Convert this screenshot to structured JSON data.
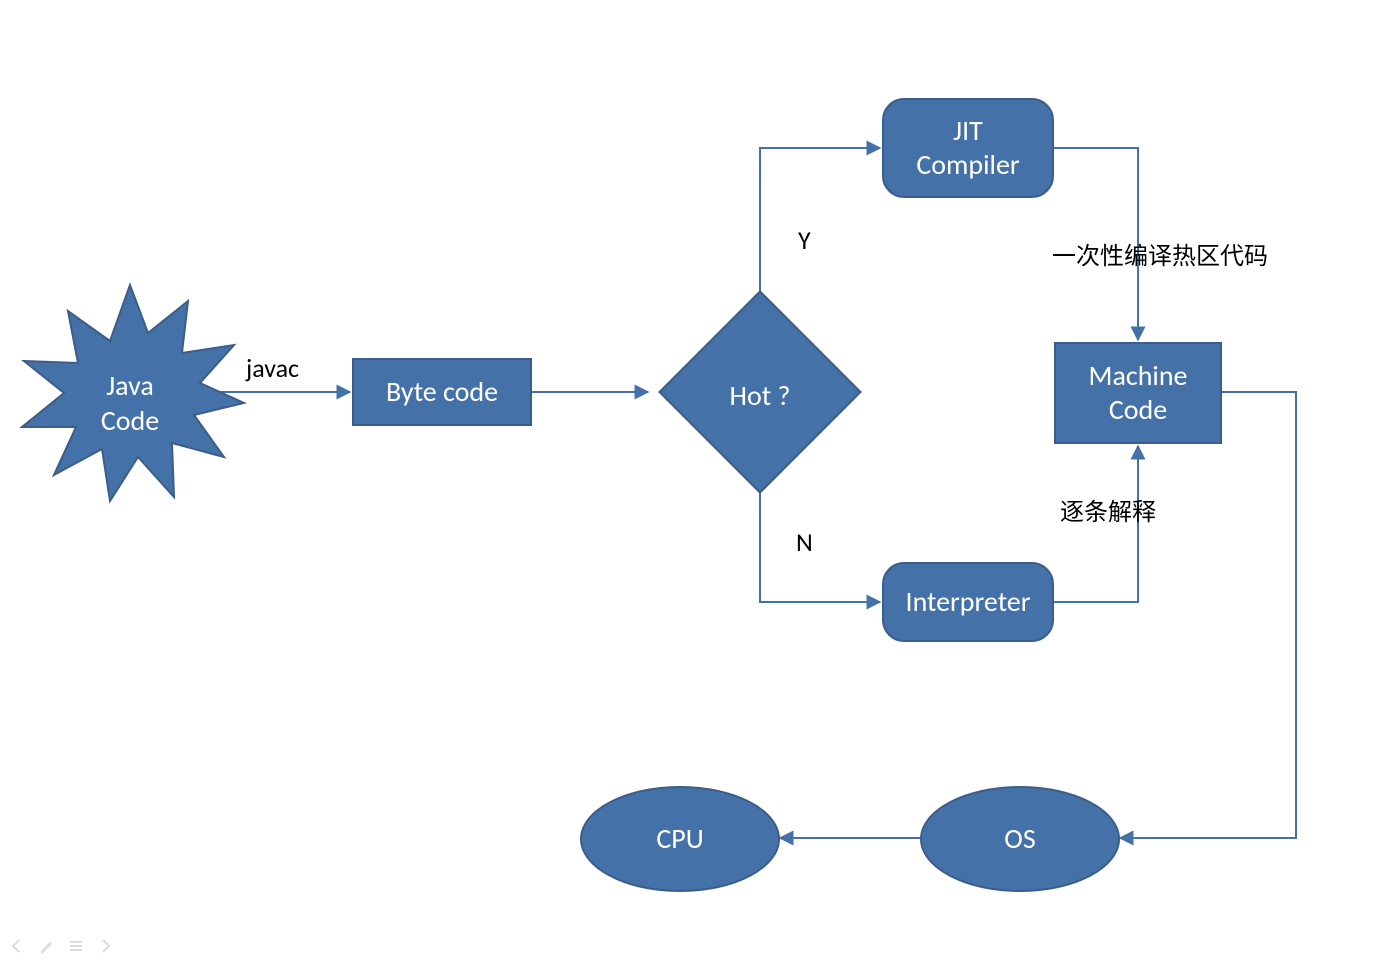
{
  "nodes": {
    "java_code": "Java\nCode",
    "byte_code": "Byte code",
    "hot": "Hot ?",
    "jit": "JIT\nCompiler",
    "interpreter": "Interpreter",
    "machine_code": "Machine\nCode",
    "cpu": "CPU",
    "os": "OS"
  },
  "edges": {
    "javac": "javac",
    "hot_yes": "Y",
    "hot_no": "N",
    "jit_to_mc": "一次性编译热区代码",
    "interp_to_mc": "逐条解释"
  },
  "colors": {
    "fill": "#4472a8",
    "stroke": "#3b5d88",
    "connector": "#4472a8"
  }
}
